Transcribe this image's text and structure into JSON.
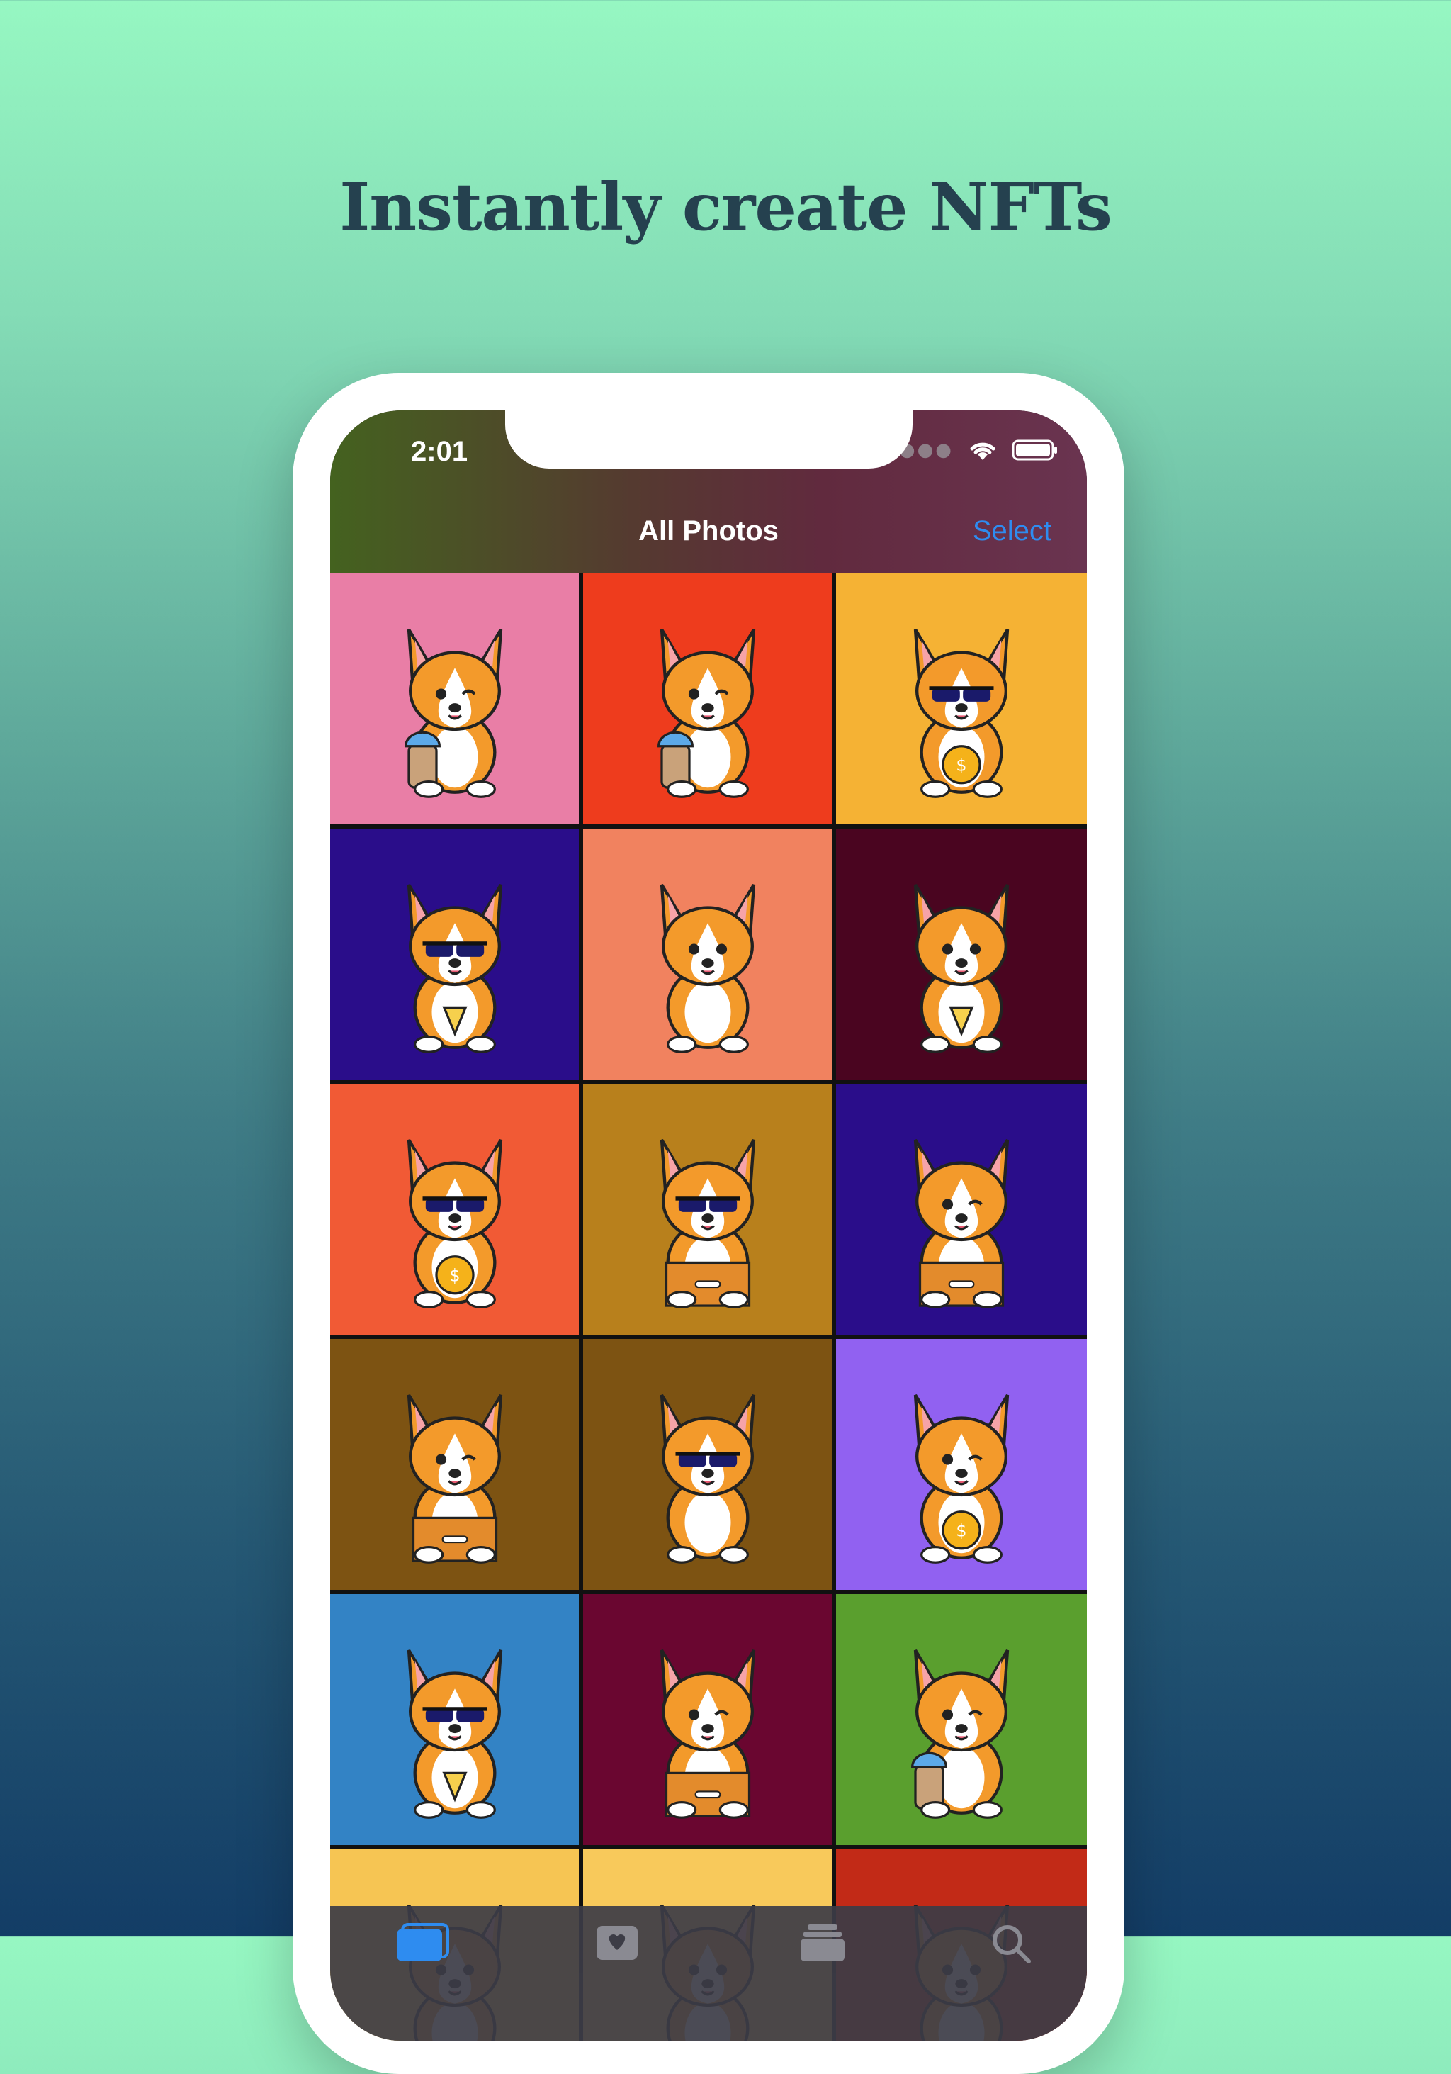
{
  "headline": "Instantly create NFTs",
  "status_bar": {
    "time": "2:01",
    "icons": [
      "cellular-dots-icon",
      "wifi-icon",
      "battery-icon"
    ]
  },
  "nav": {
    "title": "All Photos",
    "select_label": "Select"
  },
  "tabs": [
    {
      "icon": "photos-icon",
      "active": true
    },
    {
      "icon": "favorites-icon",
      "active": false
    },
    {
      "icon": "albums-icon",
      "active": false
    },
    {
      "icon": "search-icon",
      "active": false
    }
  ],
  "colors": {
    "accent": "#2e8cf0"
  },
  "grid": {
    "top_partial_row": [
      "#76c043",
      "#8a0c37",
      "#d4447b"
    ],
    "rows": [
      [
        {
          "bg": "#e97ea6",
          "variant": "boba"
        },
        {
          "bg": "#ee3c1d",
          "variant": "boba"
        },
        {
          "bg": "#f5b234",
          "variant": "coin-shades"
        }
      ],
      [
        {
          "bg": "#2a0d8a",
          "variant": "pizza-shades"
        },
        {
          "bg": "#f1825f",
          "variant": "sitting"
        },
        {
          "bg": "#4a0520",
          "variant": "pizza"
        }
      ],
      [
        {
          "bg": "#f15a35",
          "variant": "coin-shades"
        },
        {
          "bg": "#b8801c",
          "variant": "box-shades"
        },
        {
          "bg": "#2a0d8a",
          "variant": "box"
        }
      ],
      [
        {
          "bg": "#7d5312",
          "variant": "box"
        },
        {
          "bg": "#7d5312",
          "variant": "sitting-shades"
        },
        {
          "bg": "#9161f1",
          "variant": "coin"
        }
      ],
      [
        {
          "bg": "#3383c5",
          "variant": "pizza-shades"
        },
        {
          "bg": "#6a0630",
          "variant": "box"
        },
        {
          "bg": "#5a9f2e",
          "variant": "boba"
        }
      ],
      [
        {
          "bg": "#f6c553",
          "variant": "ears"
        },
        {
          "bg": "#f8c95b",
          "variant": "ears"
        },
        {
          "bg": "#c22a17",
          "variant": "ears"
        }
      ]
    ]
  }
}
